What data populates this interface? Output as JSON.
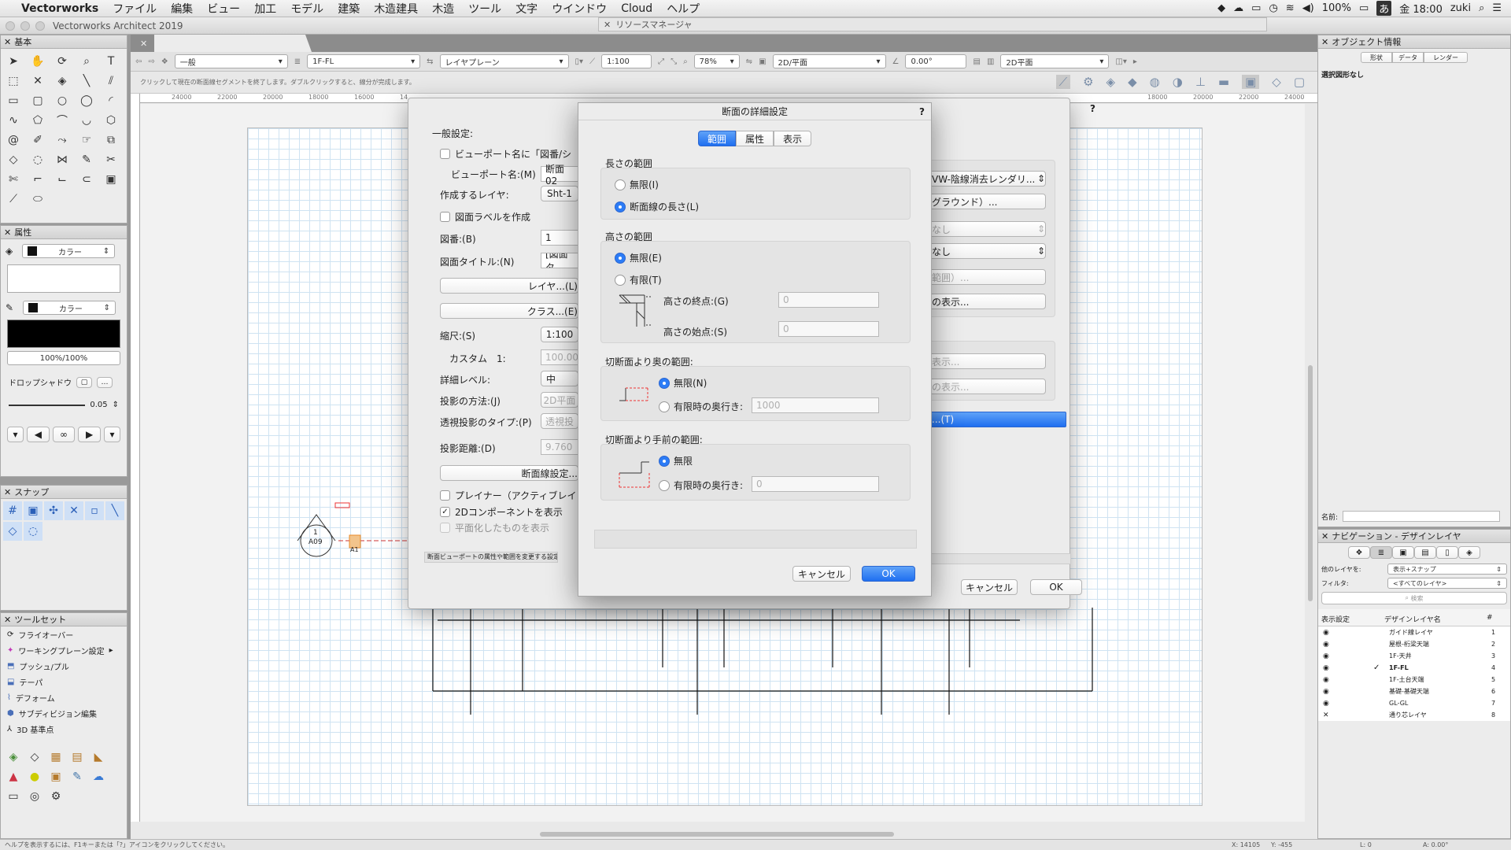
{
  "menubar": {
    "apple": "",
    "app": "Vectorworks",
    "items": [
      "ファイル",
      "編集",
      "ビュー",
      "加工",
      "モデル",
      "建築",
      "木造建具",
      "木造",
      "ツール",
      "文字",
      "ウインドウ",
      "Cloud",
      "ヘルプ"
    ],
    "battery": "100%",
    "ime": "あ",
    "clock": "金 18:00",
    "user": "zuki"
  },
  "window": {
    "title": "Vectorworks Architect 2019",
    "resource_manager": "リソースマネージャ",
    "hint": "クリックして現在の断面線セグメントを終了します。ダブルクリックすると、線分が完成します。",
    "status": "ヘルプを表示するには、F1キーまたは「?」アイコンをクリックしてください。",
    "coord_x": "X: 14105",
    "coord_y": "Y: -455",
    "coord_l": "L: 0",
    "coord_a": "A: 0.00°"
  },
  "viewbar": {
    "class": "一般",
    "layer": "1F-FL",
    "plane": "レイヤプレーン",
    "scale": "1:100",
    "zoom": "78%",
    "view": "2D/平面",
    "angle": "0.00°",
    "render": "2D平面"
  },
  "ruler": {
    "labels": [
      "24000",
      "22000",
      "20000",
      "18000",
      "16000",
      "14"
    ],
    "labels_r": [
      "18000",
      "20000",
      "22000",
      "24000"
    ]
  },
  "palettes": {
    "basic": "基本",
    "attributes": "属性",
    "color1": "カラー",
    "color2": "カラー",
    "opacity": "100%/100%",
    "drop_shadow": "ドロップシャドウ",
    "line_width": "0.05",
    "snap": "スナップ",
    "toolset": "ツールセット"
  },
  "toolset": {
    "items": [
      "フライオーバー",
      "ワーキングプレーン設定",
      "プッシュ/プル",
      "テーパ",
      "デフォーム",
      "サブディビジョン編集",
      "3D 基準点"
    ]
  },
  "obj_info": {
    "title": "オブジェクト情報",
    "tabs": [
      "形状",
      "データ",
      "レンダー"
    ],
    "none": "選択図形なし",
    "name_label": "名前:"
  },
  "nav": {
    "title": "ナビゲーション - デザインレイヤ",
    "other_label": "他のレイヤを:",
    "other_value": "表示+スナップ",
    "filter_label": "フィルタ:",
    "filter_value": "<すべてのレイヤ>",
    "search": "検索",
    "col_display": "表示設定",
    "col_name": "デザインレイヤ名",
    "col_num": "#",
    "layers": [
      {
        "name": "ガイド線レイヤ",
        "num": "1"
      },
      {
        "name": "屋根-桁梁天端",
        "num": "2"
      },
      {
        "name": "1F-天井",
        "num": "3"
      },
      {
        "name": "1F-FL",
        "num": "4"
      },
      {
        "name": "1F-土台天端",
        "num": "5"
      },
      {
        "name": "基礎-基礎天端",
        "num": "6"
      },
      {
        "name": "GL-GL",
        "num": "7"
      },
      {
        "name": "通り芯レイヤ",
        "num": "8"
      }
    ]
  },
  "drawing": {
    "marker_num": "1",
    "marker_ref": "A09",
    "tag": "A1"
  },
  "back_dialog": {
    "general": "一般設定:",
    "vp_name_cb": "ビューポート名に「図番/シ",
    "vp_name_label": "ビューポート名:(M)",
    "vp_name": "断面02",
    "layer_label": "作成するレイヤ:",
    "layer": "Sht-1",
    "label_cb": "図面ラベルを作成",
    "num_label": "図番:(B)",
    "num": "1",
    "title_label": "図面タイトル:(N)",
    "title": "[図面タ",
    "layers_btn": "レイヤ...(L)",
    "classes_btn": "クラス...(E)",
    "scale_label": "縮尺:(S)",
    "scale": "1:100",
    "custom_label": "カスタム　1:",
    "custom": "100.000",
    "detail_label": "詳細レベル:",
    "detail": "中",
    "proj_label": "投影の方法:(J)",
    "proj": "2D平面",
    "persp_label": "透視投影のタイプ:(P)",
    "persp": "透視投",
    "dist_label": "投影距離:(D)",
    "dist": "9.760",
    "section_btn": "断面線設定...",
    "planar_cb": "プレイナー（アクティブレイ",
    "comp_cb": "2Dコンポーネントを表示",
    "flat_cb": "平面化したものを表示",
    "footer": "断面ビューポートの属性や範囲を変更する設定ダイ",
    "render": "VW-陰線消去レンダリ...",
    "bg": "グラウンド）...",
    "none1": "なし",
    "none2": "なし",
    "area": "範囲）...",
    "show1": "の表示...",
    "show2": "表示...",
    "show3": "の表示...",
    "blue_btn": "...(T)",
    "cancel": "キャンセル",
    "ok": "OK"
  },
  "dialog": {
    "title": "断面の詳細設定",
    "help": "?",
    "tabs": [
      "範囲",
      "属性",
      "表示"
    ],
    "length_title": "長さの範囲",
    "len_inf": "無限(I)",
    "len_sec": "断面線の長さ(L)",
    "height_title": "高さの範囲",
    "h_inf": "無限(E)",
    "h_fin": "有限(T)",
    "h_top_label": "高さの終点:(G)",
    "h_top": "0",
    "h_bot_label": "高さの始点:(S)",
    "h_bot": "0",
    "back_title": "切断面より奥の範囲:",
    "back_inf": "無限(N)",
    "back_fin": "有限時の奥行き:",
    "back_depth": "1000",
    "front_title": "切断面より手前の範囲:",
    "front_inf": "無限",
    "front_fin": "有限時の奥行き:",
    "front_depth": "0",
    "cancel": "キャンセル",
    "ok": "OK"
  }
}
